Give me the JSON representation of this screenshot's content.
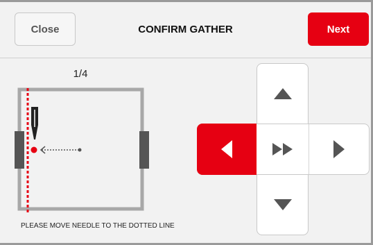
{
  "header": {
    "close_label": "Close",
    "title": "CONFIRM GATHER",
    "next_label": "Next"
  },
  "progress": {
    "step_text": "1/4"
  },
  "instruction": "PLEASE MOVE NEEDLE TO THE DOTTED LINE",
  "dpad": {
    "up_icon": "triangle-up-icon",
    "down_icon": "triangle-down-icon",
    "left_icon": "triangle-left-icon",
    "right_icon": "triangle-right-icon",
    "center_icon": "fast-forward-icon",
    "active": "left"
  },
  "colors": {
    "accent": "#e60012",
    "frame": "#a8a8a8",
    "clamp": "#555555",
    "needle_line": "#e60012"
  }
}
